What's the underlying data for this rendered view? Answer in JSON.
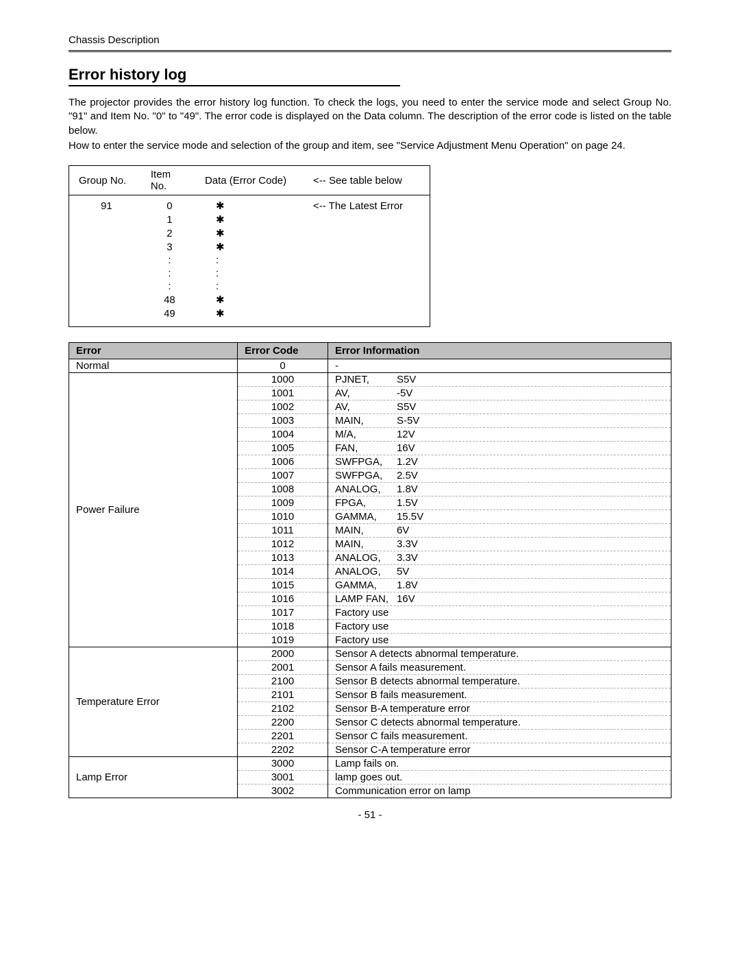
{
  "breadcrumb": "Chassis Description",
  "title": "Error history log",
  "intro": {
    "p1": "The projector provides the error history log function. To check the logs, you need to enter the service mode and select Group No. \"91\" and Item No. \"0\" to \"49\". The error code is displayed on the Data column. The description of the error code is listed on the table below.",
    "p2": "How to enter the service mode and selection of the group and item, see \"Service Adjustment Menu Operation\" on page 24."
  },
  "historyTable": {
    "headers": {
      "group": "Group No.",
      "item": "Item No.",
      "data": "Data (Error Code)",
      "see": "<-- See table below"
    },
    "groupValue": "91",
    "rows": [
      {
        "item": "0",
        "data": "✱",
        "note": "<-- The Latest Error"
      },
      {
        "item": "1",
        "data": "✱",
        "note": ""
      },
      {
        "item": "2",
        "data": "✱",
        "note": ""
      },
      {
        "item": "3",
        "data": "✱",
        "note": ""
      },
      {
        "item": ":",
        "data": ":",
        "note": ""
      },
      {
        "item": ":",
        "data": ":",
        "note": ""
      },
      {
        "item": ":",
        "data": ":",
        "note": ""
      },
      {
        "item": "48",
        "data": "✱",
        "note": ""
      },
      {
        "item": "49",
        "data": "✱",
        "note": ""
      }
    ]
  },
  "errorTable": {
    "headers": {
      "error": "Error",
      "code": "Error Code",
      "info": "Error Information"
    },
    "groups": [
      {
        "name": "Normal",
        "rows": [
          {
            "code": "0",
            "label": "-",
            "value": ""
          }
        ]
      },
      {
        "name": "Power Failure",
        "rows": [
          {
            "code": "1000",
            "label": "PJNET,",
            "value": "S5V"
          },
          {
            "code": "1001",
            "label": "AV,",
            "value": "-5V"
          },
          {
            "code": "1002",
            "label": "AV,",
            "value": "S5V"
          },
          {
            "code": "1003",
            "label": "MAIN,",
            "value": "S-5V"
          },
          {
            "code": "1004",
            "label": "M/A,",
            "value": "12V"
          },
          {
            "code": "1005",
            "label": "FAN,",
            "value": "16V"
          },
          {
            "code": "1006",
            "label": "SWFPGA,",
            "value": "1.2V"
          },
          {
            "code": "1007",
            "label": "SWFPGA,",
            "value": "2.5V"
          },
          {
            "code": "1008",
            "label": "ANALOG,",
            "value": "1.8V"
          },
          {
            "code": "1009",
            "label": "FPGA,",
            "value": "1.5V"
          },
          {
            "code": "1010",
            "label": "GAMMA,",
            "value": "15.5V"
          },
          {
            "code": "1011",
            "label": "MAIN,",
            "value": "6V"
          },
          {
            "code": "1012",
            "label": "MAIN,",
            "value": "3.3V"
          },
          {
            "code": "1013",
            "label": "ANALOG,",
            "value": "3.3V"
          },
          {
            "code": "1014",
            "label": "ANALOG,",
            "value": "5V"
          },
          {
            "code": "1015",
            "label": "GAMMA,",
            "value": "1.8V"
          },
          {
            "code": "1016",
            "label": "LAMP FAN,",
            "value": "16V"
          },
          {
            "code": "1017",
            "label": "Factory use",
            "value": ""
          },
          {
            "code": "1018",
            "label": "Factory use",
            "value": ""
          },
          {
            "code": "1019",
            "label": "Factory use",
            "value": ""
          }
        ]
      },
      {
        "name": "Temperature Error",
        "rows": [
          {
            "code": "2000",
            "label": "Sensor A detects abnormal temperature.",
            "value": ""
          },
          {
            "code": "2001",
            "label": "Sensor A fails measurement.",
            "value": ""
          },
          {
            "code": "2100",
            "label": "Sensor B detects abnormal temperature.",
            "value": ""
          },
          {
            "code": "2101",
            "label": "Sensor B fails measurement.",
            "value": ""
          },
          {
            "code": "2102",
            "label": "Sensor B-A temperature error",
            "value": ""
          },
          {
            "code": "2200",
            "label": "Sensor C detects abnormal temperature.",
            "value": ""
          },
          {
            "code": "2201",
            "label": "Sensor C fails measurement.",
            "value": ""
          },
          {
            "code": "2202",
            "label": "Sensor C-A temperature error",
            "value": ""
          }
        ]
      },
      {
        "name": "Lamp Error",
        "rows": [
          {
            "code": "3000",
            "label": "Lamp fails on.",
            "value": ""
          },
          {
            "code": "3001",
            "label": "lamp goes out.",
            "value": ""
          },
          {
            "code": "3002",
            "label": "Communication error on lamp",
            "value": ""
          }
        ]
      }
    ]
  },
  "pageNumber": "- 51 -"
}
